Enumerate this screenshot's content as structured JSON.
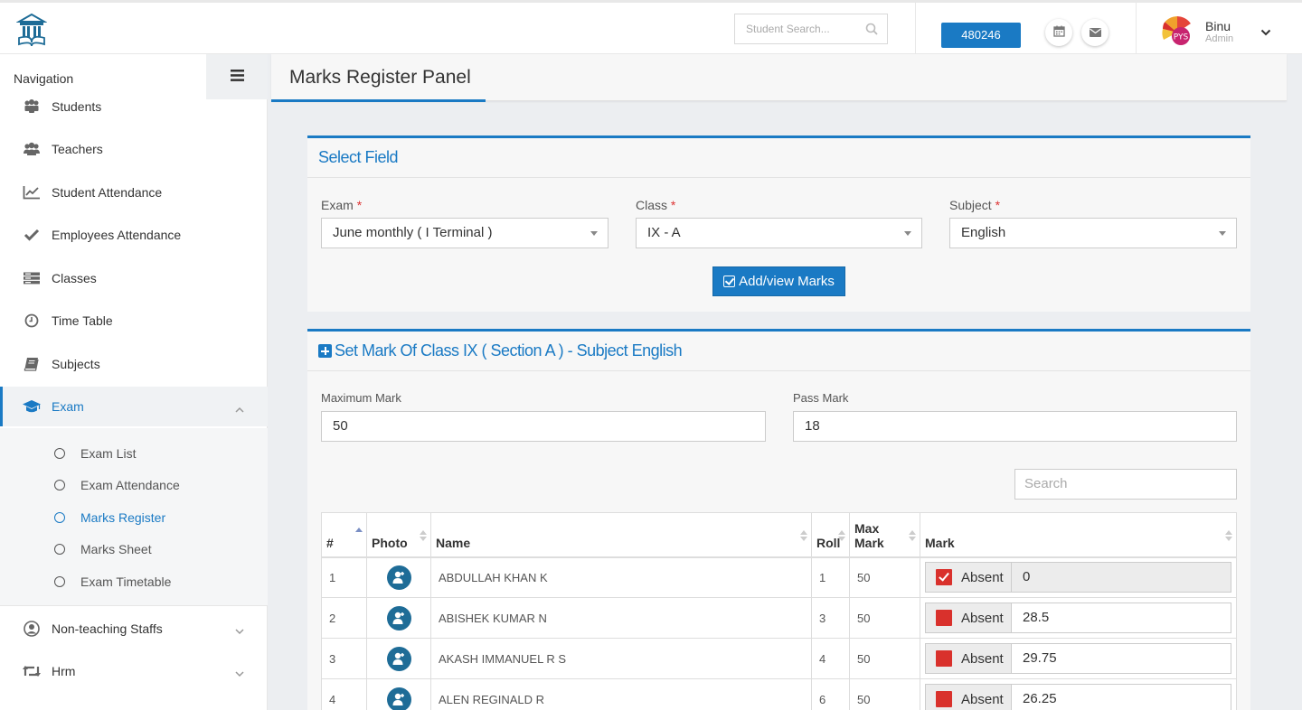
{
  "header": {
    "search_placeholder": "Student Search...",
    "id_badge": "480246",
    "user_name": "Binu",
    "user_role": "Admin"
  },
  "sidebar": {
    "title": "Navigation",
    "items": [
      {
        "label": "Students",
        "icon": "students-icon"
      },
      {
        "label": "Teachers",
        "icon": "teachers-icon"
      },
      {
        "label": "Student Attendance",
        "icon": "chart-line-icon"
      },
      {
        "label": "Employees Attendance",
        "icon": "check-icon"
      },
      {
        "label": "Classes",
        "icon": "classes-icon"
      },
      {
        "label": "Time Table",
        "icon": "clock-icon"
      },
      {
        "label": "Subjects",
        "icon": "book-icon"
      },
      {
        "label": "Exam",
        "icon": "graduation-cap-icon"
      },
      {
        "label": "Non-teaching Staffs",
        "icon": "user-circle-icon"
      },
      {
        "label": "Hrm",
        "icon": "retweet-icon"
      }
    ],
    "exam_sub": [
      {
        "label": "Exam List"
      },
      {
        "label": "Exam Attendance"
      },
      {
        "label": "Marks Register"
      },
      {
        "label": "Marks Sheet"
      },
      {
        "label": "Exam Timetable"
      }
    ]
  },
  "page": {
    "title": "Marks Register Panel"
  },
  "select_panel": {
    "title": "Select Field",
    "exam_label": "Exam",
    "exam_value": "June monthly ( I Terminal )",
    "class_label": "Class",
    "class_value": "IX - A",
    "subject_label": "Subject",
    "subject_value": "English",
    "button_label": "Add/view Marks"
  },
  "mark_panel": {
    "title": "Set Mark Of Class IX ( Section A ) - Subject English",
    "max_mark_label": "Maximum Mark",
    "max_mark_value": "50",
    "pass_mark_label": "Pass Mark",
    "pass_mark_value": "18",
    "search_placeholder": "Search",
    "columns": {
      "num": "#",
      "photo": "Photo",
      "name": "Name",
      "roll": "Roll",
      "max_mark": "Max Mark",
      "mark": "Mark"
    },
    "absent_label": "Absent",
    "rows": [
      {
        "num": "1",
        "name": "ABDULLAH KHAN K",
        "roll": "1",
        "max": "50",
        "mark": "0",
        "absent": true
      },
      {
        "num": "2",
        "name": "ABISHEK KUMAR N",
        "roll": "3",
        "max": "50",
        "mark": "28.5",
        "absent": false
      },
      {
        "num": "3",
        "name": "AKASH IMMANUEL R S",
        "roll": "4",
        "max": "50",
        "mark": "29.75",
        "absent": false
      },
      {
        "num": "4",
        "name": "ALEN REGINALD R",
        "roll": "6",
        "max": "50",
        "mark": "26.25",
        "absent": false
      }
    ]
  },
  "colors": {
    "accent": "#1a7ac4",
    "absent_checkbox": "#d9312c",
    "avatar_icon": "#1e6c97"
  }
}
